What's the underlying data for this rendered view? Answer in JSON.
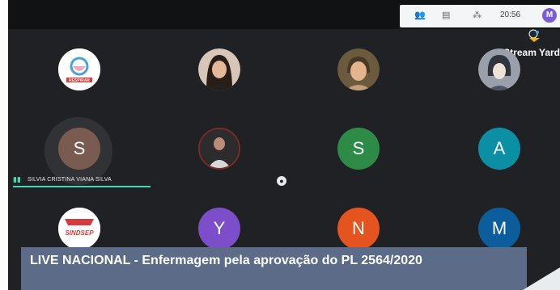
{
  "tray": {
    "time": "20:56",
    "user_initial": "M",
    "icons": [
      "people-icon",
      "chat-icon",
      "activities-icon"
    ]
  },
  "brand": {
    "label": "Stream Yard"
  },
  "tiles": [
    {
      "type": "logo",
      "caption": "RESPIRAR",
      "color": "#4aa3d8"
    },
    {
      "type": "photo",
      "color": "#c9a389"
    },
    {
      "type": "photo",
      "color": "#a88763"
    },
    {
      "type": "photo",
      "color": "#8a8f99"
    },
    {
      "type": "letter",
      "initial": "S",
      "color": "#7a5b52"
    },
    {
      "type": "photo",
      "color": "#3d3d3d"
    },
    {
      "type": "letter",
      "initial": "S",
      "color": "#2e8b47"
    },
    {
      "type": "letter",
      "initial": "A",
      "color": "#0a8fa4"
    },
    {
      "type": "logo",
      "caption": "SINDSEP",
      "color": "#d93a3a"
    },
    {
      "type": "letter",
      "initial": "Y",
      "color": "#7c4ec9"
    },
    {
      "type": "letter",
      "initial": "N",
      "color": "#e5531f"
    },
    {
      "type": "letter",
      "initial": "M",
      "color": "#0b5d9c"
    }
  ],
  "active_speaker": {
    "name": "SILVIA CRISTINA VIANA SILVA"
  },
  "banner": {
    "title": "LIVE NACIONAL - Enfermagem pela aprovação do PL 2564/2020"
  },
  "colors": {
    "background": "#202124",
    "speaking_accent": "#46d6b3",
    "banner": "#5b6b88"
  }
}
